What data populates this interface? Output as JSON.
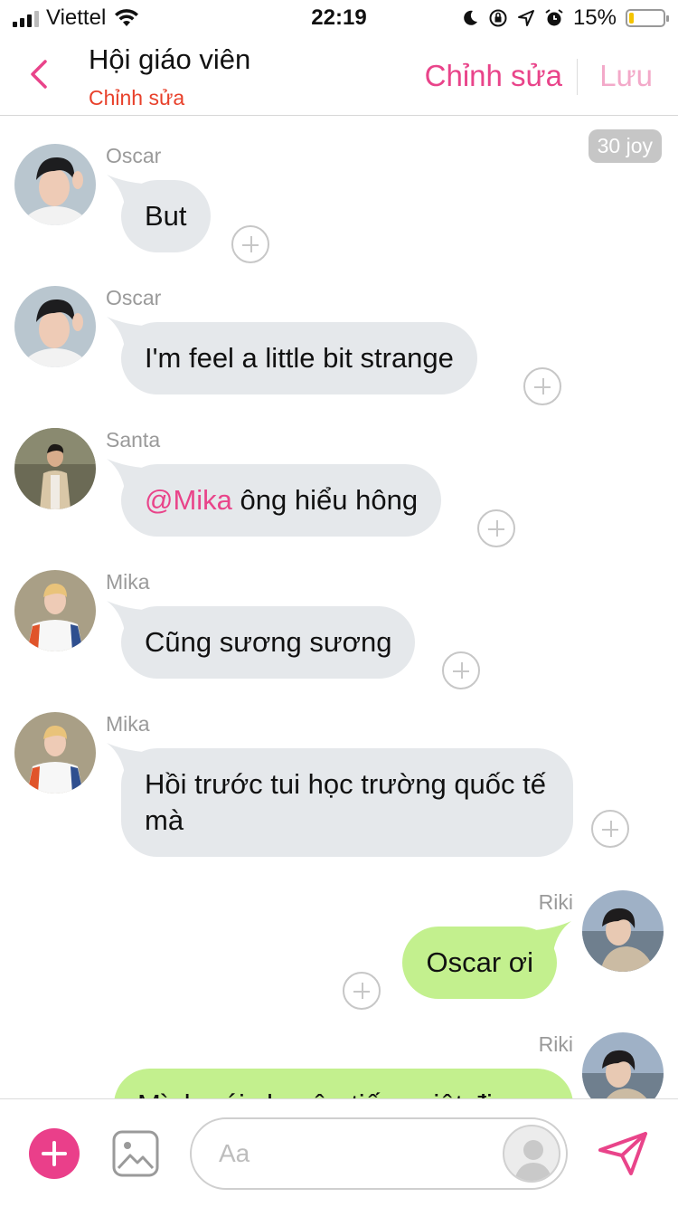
{
  "status_bar": {
    "carrier": "Viettel",
    "time": "22:19",
    "battery_percent": "15%",
    "battery_level": 0.15
  },
  "header": {
    "title": "Hội giáo viên",
    "subtitle": "Chỉnh sửa",
    "edit_label": "Chỉnh sửa",
    "save_label": "Lưu"
  },
  "chat": {
    "joy_badge": "30 joy",
    "messages": [
      {
        "sender": "Oscar",
        "text": "But",
        "direction": "incoming"
      },
      {
        "sender": "Oscar",
        "text": "I'm feel a little bit strange",
        "direction": "incoming"
      },
      {
        "sender": "Santa",
        "mention": "@Mika",
        "text": " ông hiểu hông",
        "direction": "incoming"
      },
      {
        "sender": "Mika",
        "text": "Cũng sương sương",
        "direction": "incoming"
      },
      {
        "sender": "Mika",
        "text": "Hồi trước tui học trường quốc tế mà",
        "direction": "incoming"
      },
      {
        "sender": "Riki",
        "text": "Oscar ơi",
        "direction": "outgoing"
      },
      {
        "sender": "Riki",
        "text": "Mình nói chuyện tiếng việt đi",
        "direction": "outgoing"
      }
    ]
  },
  "composer": {
    "placeholder": "Aa"
  },
  "colors": {
    "accent": "#e9448a",
    "subtitle": "#e8402a",
    "bubble_incoming": "#e5e8eb",
    "bubble_outgoing": "#c3f08e"
  },
  "icons": {
    "back": "chevron-left-icon",
    "add": "plus-icon",
    "image": "image-icon",
    "sticker": "avatar-sticker-icon",
    "send": "send-icon"
  }
}
